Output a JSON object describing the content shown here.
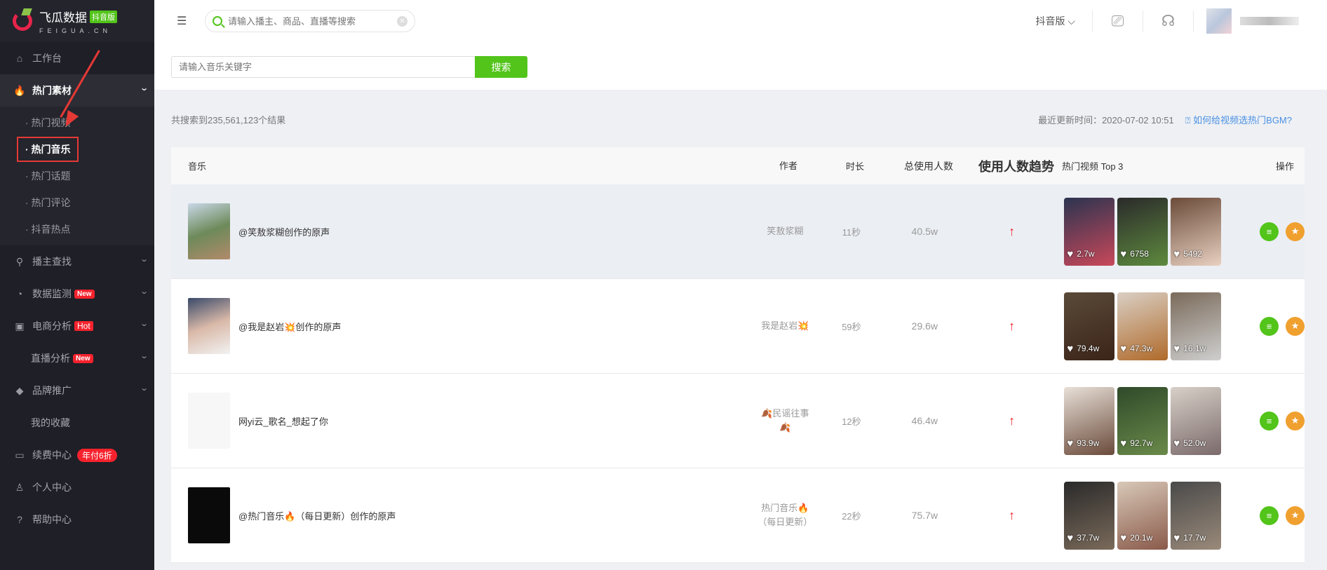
{
  "logo": {
    "name": "飞瓜数据",
    "badge": "抖音版",
    "sub": "FEIGUA.CN"
  },
  "topbar": {
    "search_placeholder": "请输入播主、商品、直播等搜索",
    "version": "抖音版"
  },
  "sidebar": {
    "items": [
      {
        "label": "工作台",
        "icon": "home-icon"
      },
      {
        "label": "热门素材",
        "icon": "fire-icon"
      },
      {
        "label": "播主查找",
        "icon": "search-icon"
      },
      {
        "label": "数据监测",
        "icon": "monitor-icon",
        "badge": "New"
      },
      {
        "label": "电商分析",
        "icon": "bag-icon",
        "badge": "Hot"
      },
      {
        "label": "直播分析",
        "badge": "New"
      },
      {
        "label": "品牌推广",
        "icon": "diamond-icon"
      },
      {
        "label": "我的收藏"
      },
      {
        "label": "续费中心",
        "icon": "card-icon",
        "badge": "年付6折"
      },
      {
        "label": "个人中心",
        "icon": "user-icon"
      },
      {
        "label": "帮助中心",
        "icon": "help-icon"
      }
    ],
    "sub_items": [
      "· 热门视频",
      "· 热门音乐",
      "· 热门话题",
      "· 热门评论",
      "· 抖音热点"
    ]
  },
  "search": {
    "placeholder": "请输入音乐关键字",
    "button": "搜索"
  },
  "result_count": "共搜索到235,561,123个结果",
  "updated": "最近更新时间：2020-07-02 10:51",
  "help_link": "⍰ 如何给视频选热门BGM?",
  "table": {
    "headers": [
      "音乐",
      "作者",
      "时长",
      "总使用人数",
      "使用人数趋势",
      "热门视频 Top 3",
      "操作"
    ],
    "rows": [
      {
        "title": "@笑敖浆糊创作的原声",
        "author": "笑敖浆糊",
        "duration": "11秒",
        "total": "40.5w",
        "trend": "↑",
        "videos": [
          "2.7w",
          "6758",
          "5492"
        ]
      },
      {
        "title": "@我是赵岩💥创作的原声",
        "author": "我是赵岩💥",
        "duration": "59秒",
        "total": "29.6w",
        "trend": "↑",
        "videos": [
          "79.4w",
          "47.3w",
          "16.1w"
        ]
      },
      {
        "title": "网yi云_歌名_想起了你",
        "author": "🍂民谣往事🍂",
        "duration": "12秒",
        "total": "46.4w",
        "trend": "↑",
        "videos": [
          "93.9w",
          "92.7w",
          "52.0w"
        ]
      },
      {
        "title": "@热门音乐🔥（每日更新）创作的原声",
        "author": "热门音乐🔥（每日更新）",
        "duration": "22秒",
        "total": "75.7w",
        "trend": "↑",
        "videos": [
          "37.7w",
          "20.1w",
          "17.7w"
        ]
      }
    ]
  },
  "colors": {
    "accent": "#52c41a",
    "favorite": "#f0a02f",
    "trend_up": "#f5222d",
    "sidebar_bg": "#1e1f27"
  }
}
